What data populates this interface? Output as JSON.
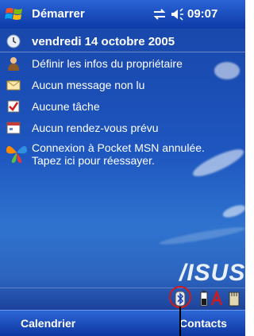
{
  "titlebar": {
    "title": "Démarrer",
    "time": "09:07",
    "icons": [
      "windows-flag-icon",
      "connectivity-icon",
      "speaker-icon"
    ]
  },
  "today": {
    "date": "vendredi 14 octobre 2005",
    "owner": "Définir les infos du propriétaire",
    "messages": "Aucun message non lu",
    "tasks": "Aucune tâche",
    "appointments": "Aucun rendez-vous prévu",
    "msn_line1": "Connexion à Pocket MSN annulée.",
    "msn_line2": "Tapez ici pour réessayer."
  },
  "brand": "/ISUS",
  "tray_icons": [
    "bluetooth-icon",
    "battery-icon",
    "font-icon",
    "memory-card-icon"
  ],
  "softkeys": {
    "left": "Calendrier",
    "right": "Contacts"
  },
  "colors": {
    "background": "#1e56bf",
    "titlebar": "#0d3aa6",
    "highlight": "#d11a1a"
  }
}
